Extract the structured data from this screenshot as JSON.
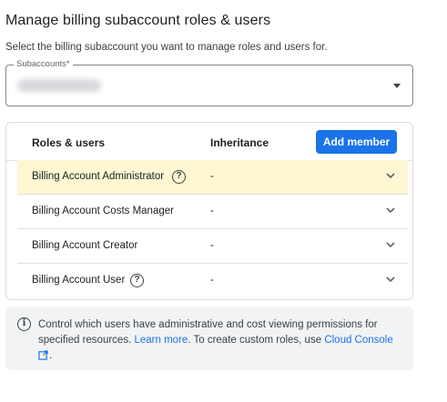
{
  "page": {
    "title": "Manage billing subaccount roles & users",
    "subtitle": "Select the billing subaccount you want to manage roles and users for."
  },
  "subaccount_select": {
    "label": "Subaccounts*",
    "value": "",
    "icon": "dropdown-arrow-icon"
  },
  "roles_table": {
    "columns": {
      "roles": "Roles & users",
      "inheritance": "Inheritance"
    },
    "add_member_label": "Add member",
    "accent_color": "#1a73e8",
    "highlight_color": "#fef7d1",
    "rows": [
      {
        "name": "Billing Account Administrator",
        "inheritance": "-",
        "has_help": true
      },
      {
        "name": "Billing Account Costs Manager",
        "inheritance": "-",
        "has_help": false
      },
      {
        "name": "Billing Account Creator",
        "inheritance": "-",
        "has_help": false
      },
      {
        "name": "Billing Account User",
        "inheritance": "-",
        "has_help": true
      }
    ]
  },
  "info_box": {
    "icon": "info-icon",
    "text_1": "Control which users have administrative and cost viewing permissions for specified resources.",
    "learn_more": "Learn more",
    "text_2": ". To create custom roles, use",
    "console_link": "Cloud Console",
    "text_end": "."
  }
}
